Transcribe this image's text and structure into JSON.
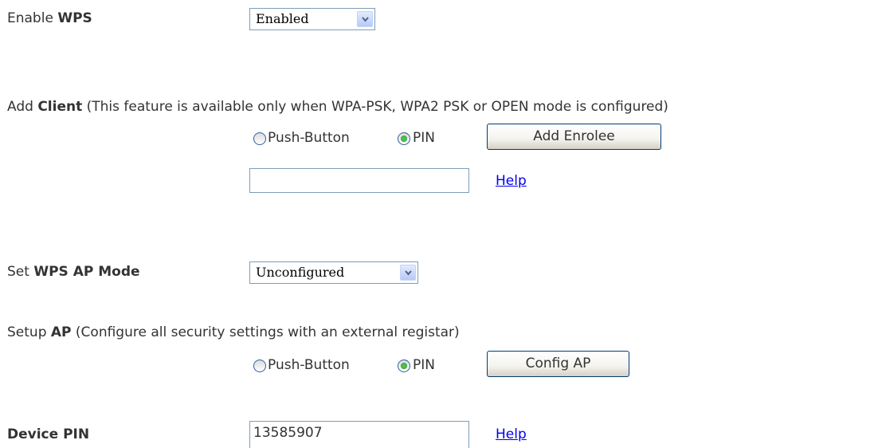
{
  "enable_wps": {
    "label_prefix": "Enable ",
    "label_bold": "WPS",
    "select_value": "Enabled"
  },
  "add_client": {
    "label_prefix": "Add ",
    "label_bold": "Client",
    "note": "(This feature is available only when WPA-PSK, WPA2 PSK or OPEN mode is configured)",
    "radio_push_label": "Push-Button",
    "radio_pin_label": "PIN",
    "selected_method": "PIN",
    "button_label": "Add Enrolee",
    "pin_input_value": "",
    "help_label": "Help"
  },
  "wps_ap_mode": {
    "label_prefix": "Set ",
    "label_bold": "WPS AP Mode",
    "select_value": "Unconfigured"
  },
  "setup_ap": {
    "label_prefix": "Setup ",
    "label_bold": "AP",
    "note": "(Configure all security settings with an external registar)",
    "radio_push_label": "Push-Button",
    "radio_pin_label": "PIN",
    "selected_method": "PIN",
    "button_label": "Config AP"
  },
  "device_pin": {
    "label": "Device PIN",
    "value": "13585907",
    "help_label": "Help"
  },
  "colors": {
    "text": "#333333",
    "link": "#0000ee",
    "input_border": "#7f9db9",
    "radio_checked": "#2aa52a"
  }
}
